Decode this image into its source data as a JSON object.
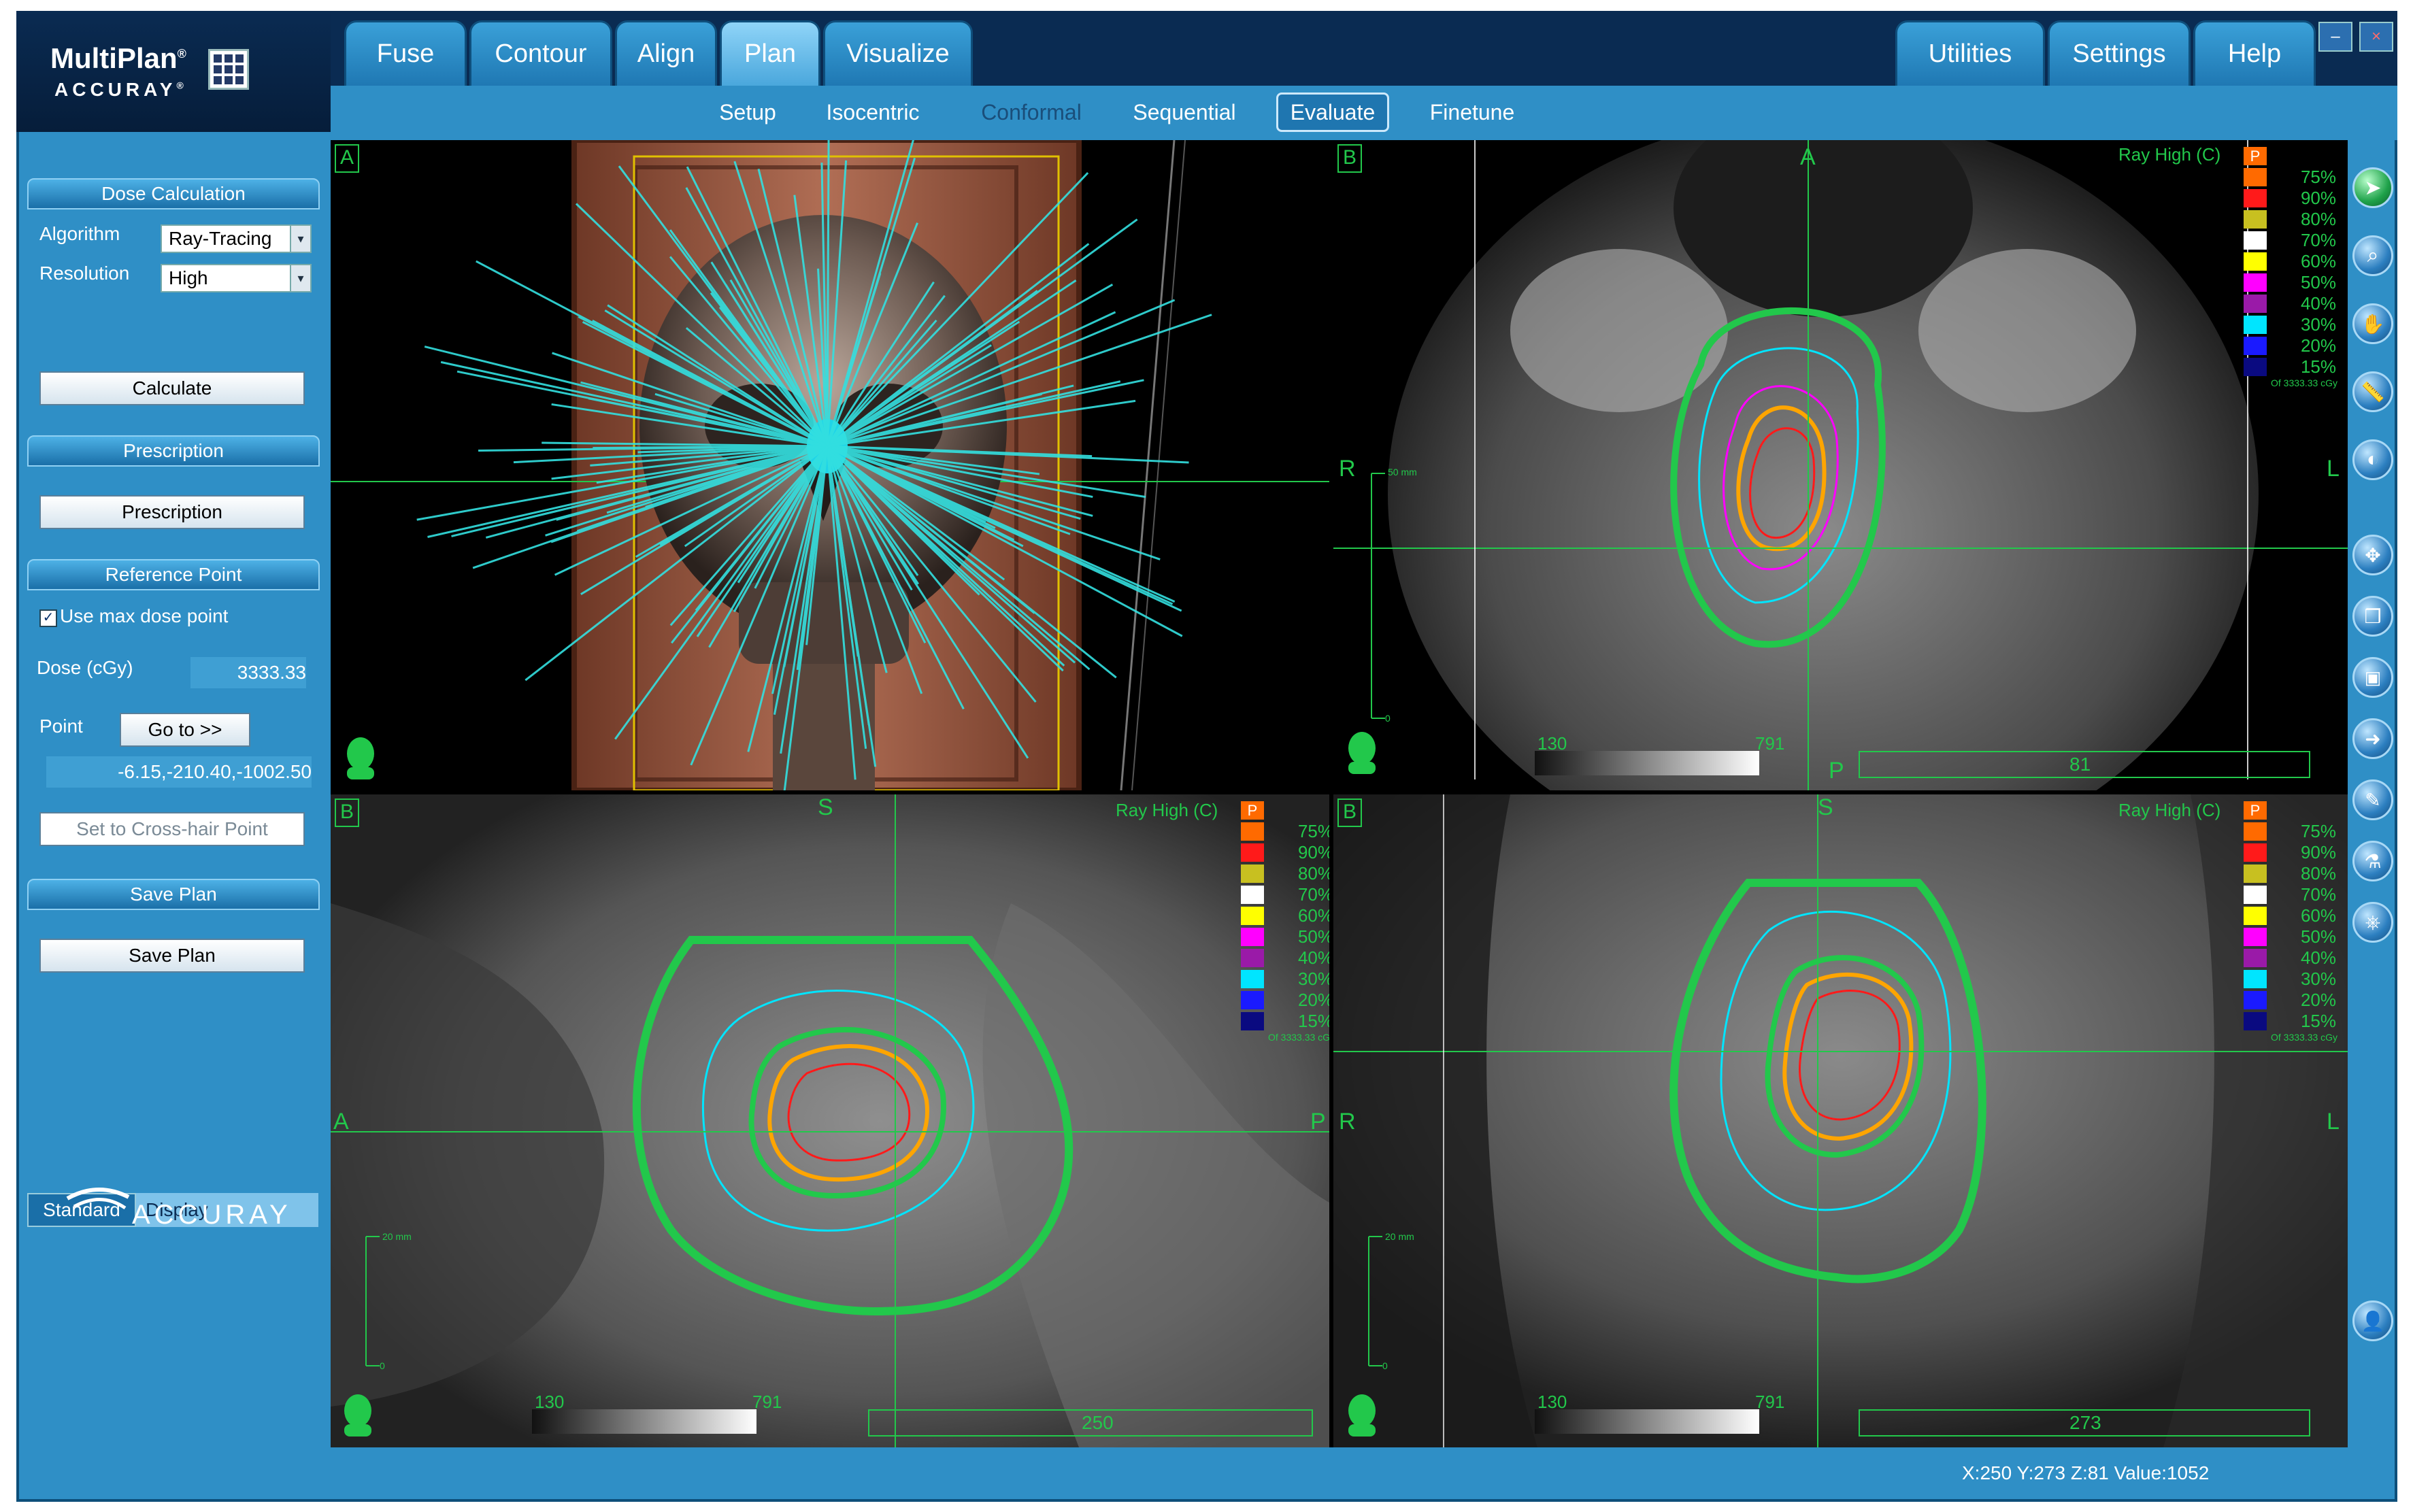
{
  "app": {
    "title_main": "MultiPlan",
    "title_sub": "ACCURAY",
    "footer_logo": "ACCURAY"
  },
  "tabs": {
    "left": [
      "Fuse",
      "Contour",
      "Align",
      "Plan",
      "Visualize"
    ],
    "right": [
      "Utilities",
      "Settings",
      "Help"
    ],
    "active": "Plan"
  },
  "window": {
    "minimize": "–",
    "close": "×"
  },
  "subtabs": {
    "items": [
      "Setup",
      "Isocentric",
      "Conformal",
      "Sequential",
      "Evaluate",
      "Finetune"
    ],
    "active": "Evaluate"
  },
  "left_panel": {
    "dose_calc": {
      "header": "Dose Calculation",
      "algorithm_label": "Algorithm",
      "algorithm_value": "Ray-Tracing",
      "resolution_label": "Resolution",
      "resolution_value": "High",
      "calculate_button": "Calculate"
    },
    "prescription": {
      "header": "Prescription",
      "button": "Prescription"
    },
    "reference_point": {
      "header": "Reference Point",
      "use_max_label": "Use max dose point",
      "use_max_checked": true,
      "dose_label": "Dose (cGy)",
      "dose_value": "3333.33",
      "point_label": "Point",
      "goto_button": "Go to >>",
      "point_value": "-6.15,-210.40,-1002.50",
      "crosshair_button": "Set to Cross-hair Point"
    },
    "save_plan": {
      "header": "Save Plan",
      "button": "Save Plan"
    },
    "tabs": [
      "Standard",
      "Display"
    ]
  },
  "viewports": {
    "a": {
      "label": "A"
    },
    "b1": {
      "label": "B",
      "ray": "Ray High (C)",
      "orient_top": "A",
      "orient_left": "R",
      "orient_right": "L",
      "orient_bottom": "P",
      "scale": "50 mm",
      "scale_zero": "0",
      "wl_min": "130",
      "wl_max": "791",
      "slice": "81"
    },
    "b2": {
      "label": "B",
      "ray": "Ray High (C)",
      "orient_top": "S",
      "orient_left": "A",
      "orient_right": "P",
      "scale": "20 mm",
      "scale_zero": "0",
      "wl_min": "130",
      "wl_max": "791",
      "slice": "250"
    },
    "b3": {
      "label": "B",
      "ray": "Ray High (C)",
      "orient_top": "S",
      "orient_left": "R",
      "orient_right": "L",
      "scale": "20 mm",
      "scale_zero": "0",
      "wl_min": "130",
      "wl_max": "791",
      "slice": "273"
    }
  },
  "legend": {
    "header": "P",
    "items": [
      {
        "pct": "75%",
        "color": "#ff6a00"
      },
      {
        "pct": "90%",
        "color": "#ff1a1a"
      },
      {
        "pct": "80%",
        "color": "#c8c020"
      },
      {
        "pct": "70%",
        "color": "#ffffff"
      },
      {
        "pct": "60%",
        "color": "#ffff00"
      },
      {
        "pct": "50%",
        "color": "#ff00ff"
      },
      {
        "pct": "40%",
        "color": "#9a1aa8"
      },
      {
        "pct": "30%",
        "color": "#00e5ff"
      },
      {
        "pct": "20%",
        "color": "#1a1aff"
      },
      {
        "pct": "15%",
        "color": "#0a0a80"
      }
    ],
    "footer": "Of 3333.33 cGy"
  },
  "toolbar": [
    "pointer-icon",
    "zoom-icon",
    "pan-hand-icon",
    "ruler-icon",
    "window-level-icon",
    "fit-view-icon",
    "cube-icon",
    "save-disk-icon",
    "arrow-icon",
    "edit-icon",
    "bottle-icon",
    "stamp-icon",
    "person-icon"
  ],
  "status": "X:250 Y:273 Z:81  Value:1052",
  "colors": {
    "accent": "#2f8fc6",
    "overlay_green": "#22c84b",
    "beam": "#33e0e0"
  }
}
